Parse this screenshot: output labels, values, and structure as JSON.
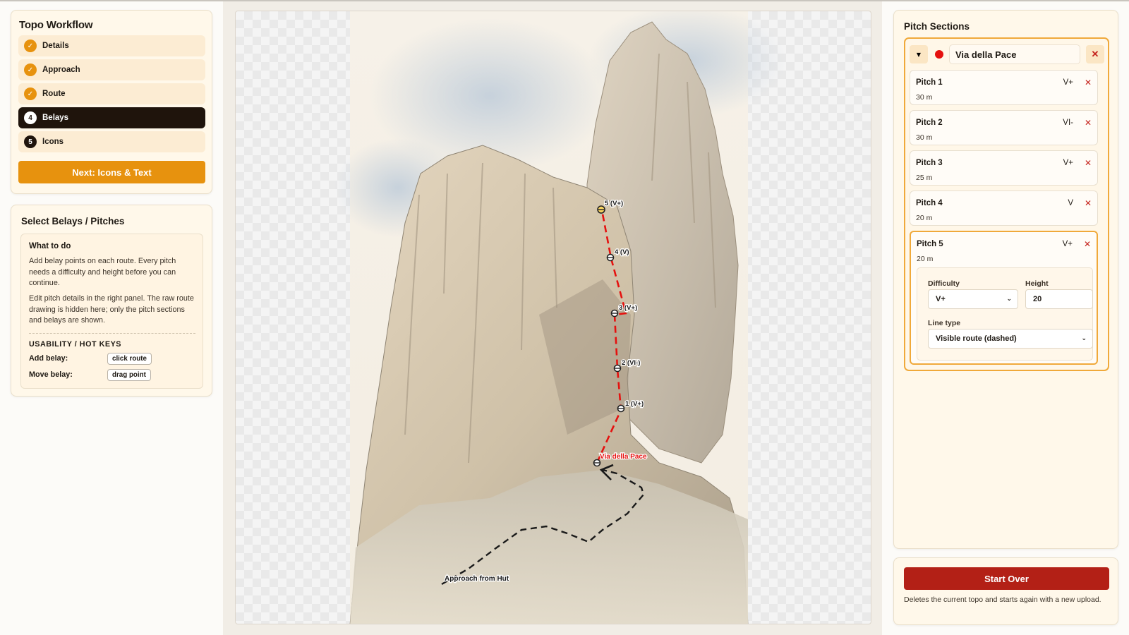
{
  "workflow": {
    "title": "Topo Workflow",
    "steps": [
      {
        "label": "Details",
        "state": "done",
        "badge": ""
      },
      {
        "label": "Approach",
        "state": "done",
        "badge": ""
      },
      {
        "label": "Route",
        "state": "done",
        "badge": ""
      },
      {
        "label": "Belays",
        "state": "active",
        "badge": "4"
      },
      {
        "label": "Icons",
        "state": "todo",
        "badge": "5"
      }
    ],
    "next_label": "Next: Icons & Text"
  },
  "belay_panel": {
    "title": "Select Belays / Pitches",
    "help_title": "What to do",
    "help_p1": "Add belay points on each route. Every pitch needs a difficulty and height before you can continue.",
    "help_p2": "Edit pitch details in the right panel. The raw route drawing is hidden here; only the pitch sections and belays are shown.",
    "hotkeys_title": "USABILITY / HOT KEYS",
    "hotkeys": [
      {
        "label": "Add belay:",
        "key": "click route"
      },
      {
        "label": "Move belay:",
        "key": "drag point"
      }
    ]
  },
  "topo": {
    "route_label": "Via della Pace",
    "approach_label": "Approach from Hut",
    "belay_labels": [
      "1 (V+)",
      "2 (VI-)",
      "3 (V+)",
      "4 (V)",
      "5 (V+)"
    ],
    "route_color": "#e5110f"
  },
  "sections": {
    "title": "Pitch Sections",
    "route_name": "Via della Pace",
    "route_color": "#e5110f",
    "pitches": [
      {
        "name": "Pitch 1",
        "length": "30 m",
        "grade": "V+"
      },
      {
        "name": "Pitch 2",
        "length": "30 m",
        "grade": "VI-"
      },
      {
        "name": "Pitch 3",
        "length": "25 m",
        "grade": "V+"
      },
      {
        "name": "Pitch 4",
        "length": "20 m",
        "grade": "V"
      },
      {
        "name": "Pitch 5",
        "length": "20 m",
        "grade": "V+"
      }
    ],
    "form": {
      "difficulty_label": "Difficulty",
      "difficulty_value": "V+",
      "height_label": "Height",
      "height_value": "20",
      "line_type_label": "Line type",
      "line_type_value": "Visible route (dashed)"
    }
  },
  "start_over": {
    "label": "Start Over",
    "note": "Deletes the current topo and starts again with a new upload."
  },
  "icons": {
    "done": "check-icon",
    "collapse": "caret-down-icon",
    "delete": "close-icon",
    "select": "chevron-down-icon"
  }
}
